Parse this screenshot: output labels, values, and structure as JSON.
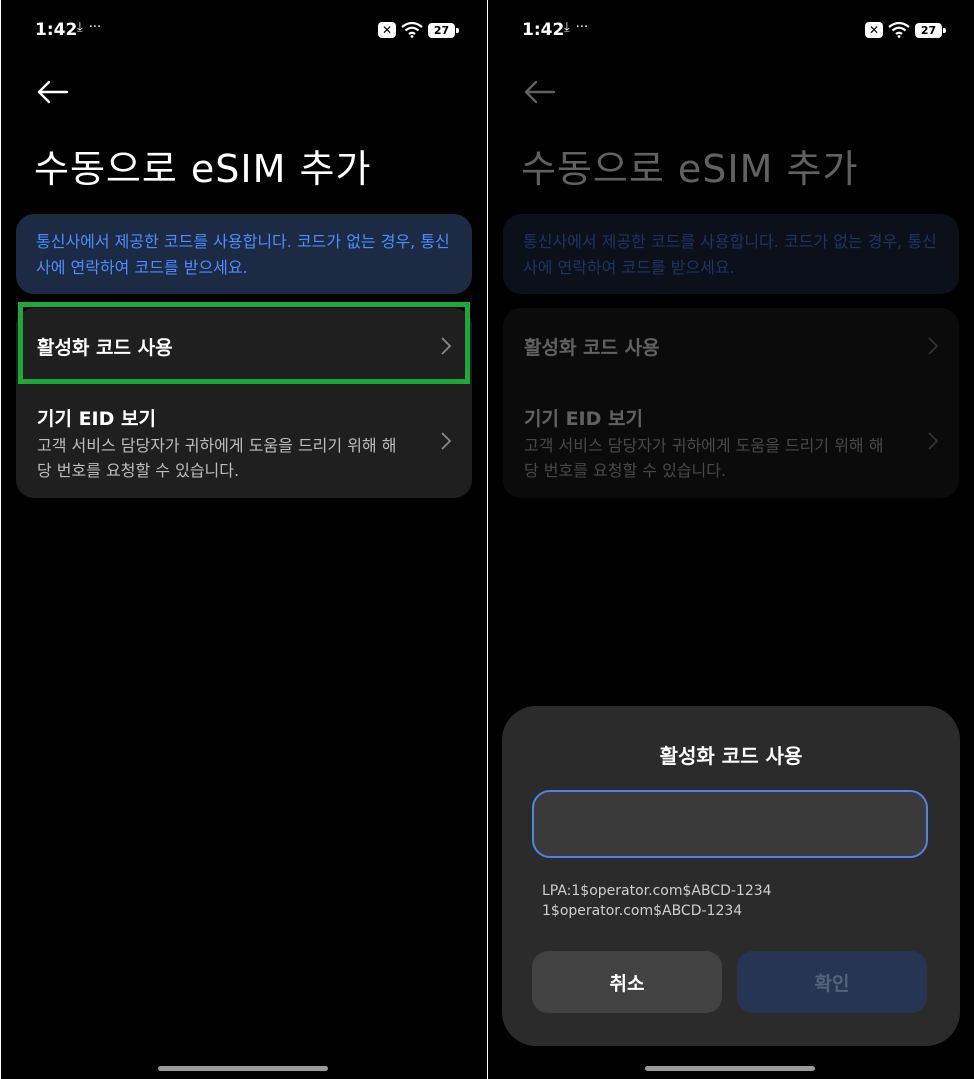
{
  "status_bar": {
    "time": "1:42",
    "left_icons": [
      "download-icon",
      "more-dots-icon"
    ],
    "battery_level": "27",
    "sim_status_icon": "sim-off-icon",
    "wifi_icon": "wifi-icon"
  },
  "page": {
    "title": "수동으로 eSIM 추가",
    "info_text": "통신사에서 제공한 코드를 사용합니다. 코드가 없는 경우, 통신사에 연락하여 코드를 받으세요.",
    "options": [
      {
        "title": "활성화 코드 사용",
        "description": ""
      },
      {
        "title": "기기 EID 보기",
        "description": "고객 서비스 담당자가 귀하에게 도움을 드리기 위해 해당 번호를 요청할 수 있습니다."
      }
    ]
  },
  "dialog": {
    "title": "활성화 코드 사용",
    "input_value": "",
    "hint_line_1": "LPA:1$operator.com$ABCD-1234",
    "hint_line_2": "1$operator.com$ABCD-1234",
    "cancel_label": "취소",
    "confirm_label": "확인"
  },
  "colors": {
    "background": "#000000",
    "card": "#1f1f1f",
    "info_banner_bg": "#1d2a44",
    "info_text": "#4d8dff",
    "highlight": "#1ea83a",
    "input_border": "#4f86e6",
    "confirm_bg": "#253553"
  }
}
